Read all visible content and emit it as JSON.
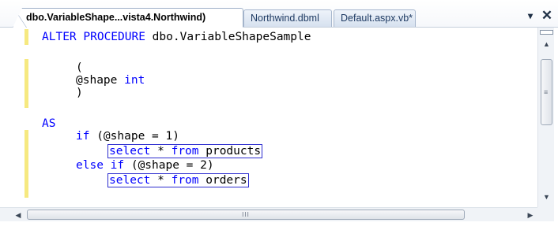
{
  "tabs": [
    {
      "label": "dbo.VariableShape...vista4.Northwind)",
      "active": true
    },
    {
      "label": "Northwind.dbml",
      "active": false
    },
    {
      "label": "Default.aspx.vb*",
      "active": false
    }
  ],
  "window_buttons": {
    "dropdown": "▾",
    "close": "✕"
  },
  "code": {
    "line1_kw": "ALTER PROCEDURE",
    "line1_rest": " dbo.VariableShapeSample",
    "line3": "(",
    "line4_param": "@shape ",
    "line4_type": "int",
    "line5": ")",
    "line7_kw": "AS",
    "line8_kw": "if",
    "line8_rest": " (@shape = 1)",
    "line9_kw": "select",
    "line9_mid": " * ",
    "line9_kw2": "from",
    "line9_rest": " products",
    "line10_kw": "else if",
    "line10_rest": " (@shape = 2)",
    "line11_kw": "select",
    "line11_mid": " * ",
    "line11_kw2": "from",
    "line11_rest": " orders"
  },
  "colors": {
    "keyword": "#0000ff",
    "change_bar": "#f6e980",
    "selection_box": "#2d2dcf"
  },
  "scrollbars": {
    "up_arrow": "▲",
    "down_arrow": "▼",
    "left_arrow": "◀",
    "right_arrow": "▶",
    "vertical_grip": "≡",
    "horizontal_grip": "III"
  }
}
